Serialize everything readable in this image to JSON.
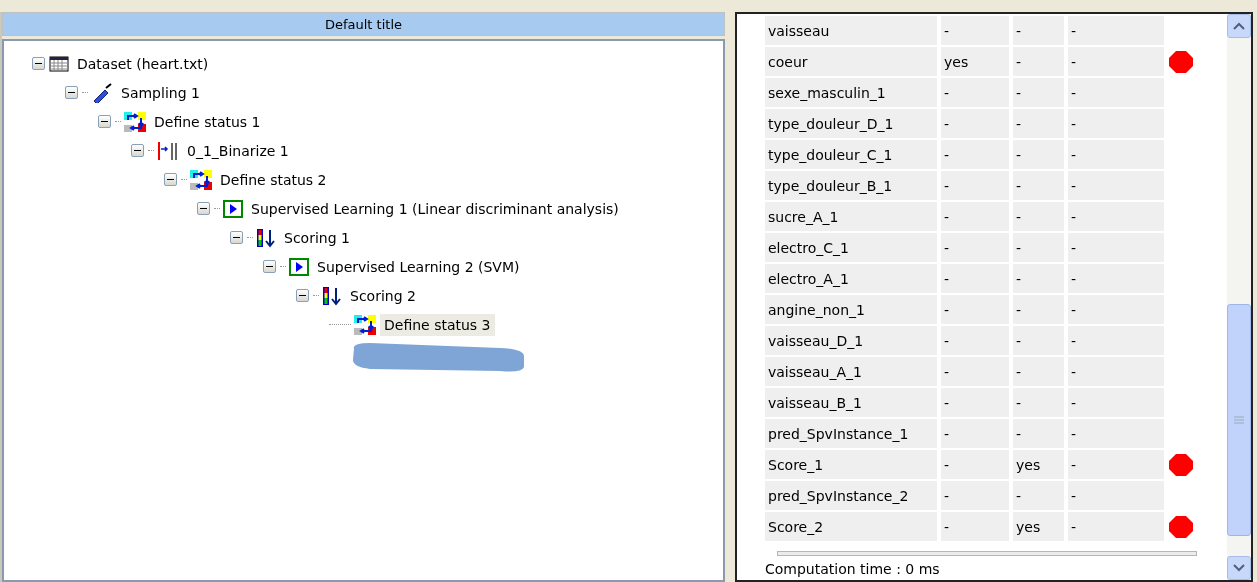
{
  "left_panel": {
    "title": "Default title",
    "tree": [
      {
        "label": "Dataset (heart.txt)",
        "kind": "dataset",
        "expanded": true,
        "selected": false,
        "children": [
          {
            "label": "Sampling 1",
            "kind": "sampling",
            "expanded": true,
            "selected": false,
            "children": [
              {
                "label": "Define status 1",
                "kind": "status",
                "expanded": true,
                "selected": false,
                "children": [
                  {
                    "label": "0_1_Binarize 1",
                    "kind": "binarize",
                    "expanded": true,
                    "selected": false,
                    "children": [
                      {
                        "label": "Define status 2",
                        "kind": "status",
                        "expanded": true,
                        "selected": false,
                        "children": [
                          {
                            "label": "Supervised Learning 1 (Linear discriminant analysis)",
                            "kind": "learning",
                            "expanded": true,
                            "selected": false,
                            "children": [
                              {
                                "label": "Scoring 1",
                                "kind": "scoring",
                                "expanded": true,
                                "selected": false,
                                "children": [
                                  {
                                    "label": "Supervised Learning 2 (SVM)",
                                    "kind": "learning",
                                    "expanded": true,
                                    "selected": false,
                                    "children": [
                                      {
                                        "label": "Scoring 2",
                                        "kind": "scoring",
                                        "expanded": true,
                                        "selected": false,
                                        "children": [
                                          {
                                            "label": "Define status 3",
                                            "kind": "status",
                                            "selected": true
                                          }
                                        ]
                                      }
                                    ]
                                  }
                                ]
                              }
                            ]
                          }
                        ]
                      }
                    ]
                  }
                ]
              }
            ]
          }
        ]
      }
    ]
  },
  "right_panel": {
    "rows": [
      {
        "cells": [
          "vaisseau",
          "-",
          "-",
          "-"
        ],
        "flag": false
      },
      {
        "cells": [
          "coeur",
          "yes",
          "-",
          "-"
        ],
        "flag": true
      },
      {
        "cells": [
          "sexe_masculin_1",
          "-",
          "-",
          "-"
        ],
        "flag": false
      },
      {
        "cells": [
          "type_douleur_D_1",
          "-",
          "-",
          "-"
        ],
        "flag": false
      },
      {
        "cells": [
          "type_douleur_C_1",
          "-",
          "-",
          "-"
        ],
        "flag": false
      },
      {
        "cells": [
          "type_douleur_B_1",
          "-",
          "-",
          "-"
        ],
        "flag": false
      },
      {
        "cells": [
          "sucre_A_1",
          "-",
          "-",
          "-"
        ],
        "flag": false
      },
      {
        "cells": [
          "electro_C_1",
          "-",
          "-",
          "-"
        ],
        "flag": false
      },
      {
        "cells": [
          "electro_A_1",
          "-",
          "-",
          "-"
        ],
        "flag": false
      },
      {
        "cells": [
          "angine_non_1",
          "-",
          "-",
          "-"
        ],
        "flag": false
      },
      {
        "cells": [
          "vaisseau_D_1",
          "-",
          "-",
          "-"
        ],
        "flag": false
      },
      {
        "cells": [
          "vaisseau_A_1",
          "-",
          "-",
          "-"
        ],
        "flag": false
      },
      {
        "cells": [
          "vaisseau_B_1",
          "-",
          "-",
          "-"
        ],
        "flag": false
      },
      {
        "cells": [
          "pred_SpvInstance_1",
          "-",
          "-",
          "-"
        ],
        "flag": false
      },
      {
        "cells": [
          "Score_1",
          "-",
          "yes",
          "-"
        ],
        "flag": true
      },
      {
        "cells": [
          "pred_SpvInstance_2",
          "-",
          "-",
          "-"
        ],
        "flag": false
      },
      {
        "cells": [
          "Score_2",
          "-",
          "yes",
          "-"
        ],
        "flag": true
      }
    ],
    "status": "Computation time : 0 ms"
  }
}
